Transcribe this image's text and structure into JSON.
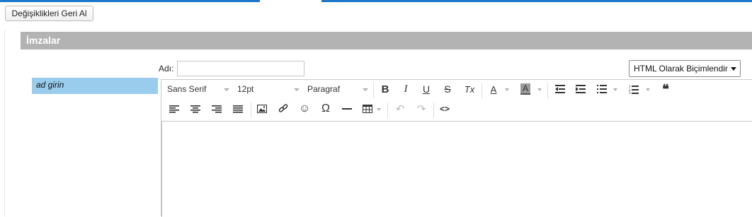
{
  "header": {
    "revert_button_label": "Değişiklikleri Geri Al"
  },
  "section": {
    "title": "İmzalar"
  },
  "signature_list": {
    "items": [
      {
        "label": "ad girin",
        "selected": true
      }
    ]
  },
  "name_field": {
    "label": "Adı:",
    "value": "",
    "placeholder": ""
  },
  "format_select": {
    "selected": "HTML Olarak Biçimlendir"
  },
  "editor": {
    "font_family": "Sans Serif",
    "font_size": "12pt",
    "paragraph_style": "Paragraf",
    "icons": {
      "bold": "B",
      "italic": "I",
      "underline": "U",
      "strikethrough": "S",
      "clear_format": "Tx",
      "text_color": "A",
      "bg_color": "A",
      "blockquote": "❝",
      "omega": "Ω",
      "emoji": "☺",
      "undo": "↶",
      "redo": "↷",
      "source": "<>"
    },
    "content": ""
  },
  "colors": {
    "accent": "#1a77c9",
    "section_header_bg": "#b3b3b3",
    "selected_item_bg": "#99cced"
  }
}
